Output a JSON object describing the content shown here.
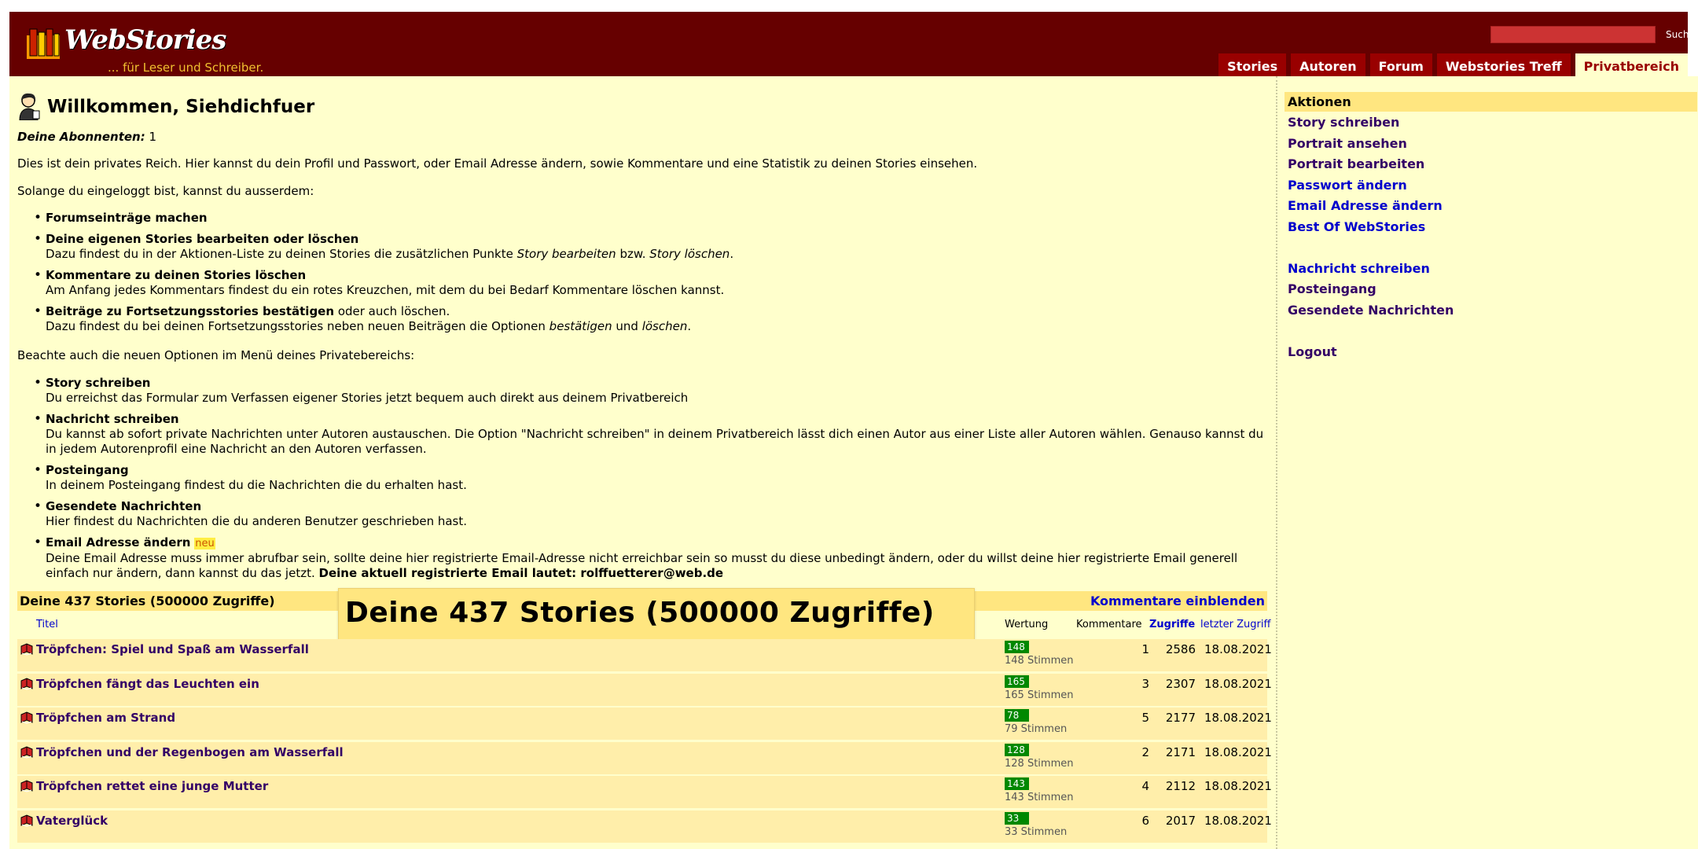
{
  "header": {
    "logo_title": "WebStories",
    "logo_slogan": "... für Leser und Schreiber.",
    "search_button": "Suchen",
    "nav": [
      "Stories",
      "Autoren",
      "Forum",
      "Webstories Treff",
      "Privatbereich"
    ],
    "active_nav": "Privatbereich"
  },
  "welcome": {
    "title": "Willkommen, Siehdichfuer",
    "subscribers_label": "Deine Abonnenten:",
    "subscribers_value": "1",
    "intro": "Dies ist dein privates Reich. Hier kannst du dein Profil und Passwort, oder Email Adresse ändern, sowie Kommentare und eine Statistik zu deinen Stories einsehen.",
    "logged_in_intro": "Solange du eingeloggt bist, kannst du ausserdem:",
    "b1_title": "Forumseinträge machen",
    "b2_title": "Deine eigenen Stories bearbeiten oder löschen",
    "b2_text_a": "Dazu findest du in der Aktionen-Liste zu deinen Stories die zusätzlichen Punkte ",
    "b2_text_it1": "Story bearbeiten",
    "b2_text_b": " bzw. ",
    "b2_text_it2": "Story löschen",
    "b2_text_c": ".",
    "b3_title": "Kommentare zu deinen Stories löschen",
    "b3_text": "Am Anfang jedes Kommentars findest du ein rotes Kreuzchen, mit dem du bei Bedarf Kommentare löschen kannst.",
    "b4_title": "Beiträge zu Fortsetzungsstories bestätigen",
    "b4_title_suffix": " oder auch löschen.",
    "b4_text_a": "Dazu findest du bei deinen Fortsetzungsstories neben neuen Beiträgen die Optionen ",
    "b4_text_it1": "bestätigen",
    "b4_text_b": " und ",
    "b4_text_it2": "löschen",
    "b4_text_c": ".",
    "new_options_intro": "Beachte auch die neuen Optionen im Menü deines Privatebereichs:",
    "n1_title": "Story schreiben",
    "n1_text": "Du erreichst das Formular zum Verfassen eigener Stories jetzt bequem auch direkt aus deinem Privatbereich",
    "n2_title": "Nachricht schreiben",
    "n2_text": "Du kannst ab sofort private Nachrichten unter Autoren austauschen. Die Option \"Nachricht schreiben\" in deinem Privatbereich lässt dich einen Autor aus einer Liste aller Autoren wählen. Genauso kannst du in jedem Autorenprofil eine Nachricht an den Autoren verfassen.",
    "n3_title": "Posteingang",
    "n3_text": "In deinem Posteingang findest du die Nachrichten die du erhalten hast.",
    "n4_title": "Gesendete Nachrichten",
    "n4_text": "Hier findest du Nachrichten die du anderen Benutzer geschrieben hast.",
    "n5_title": "Email Adresse ändern",
    "n5_badge": "neu",
    "n5_text": "Deine Email Adresse muss immer abrufbar sein, sollte deine hier registrierte Email-Adresse nicht erreichbar sein so musst du diese unbedingt ändern, oder du willst deine hier registrierte Email generell einfach nur ändern, dann kannst du das jetzt. ",
    "n5_bold": "Deine aktuell registrierte Email lautet: rolffuetterer@web.de"
  },
  "stories": {
    "bar_title": "Deine 437 Stories (500000 Zugriffe)",
    "zoom_title": "Deine 437 Stories (500000 Zugriffe)",
    "toggle_comments": "Kommentare einblenden",
    "columns": {
      "title": "Titel",
      "rating": "Wertung",
      "comments": "Kommentare",
      "views": "Zugriffe",
      "last": "letzter Zugriff"
    },
    "rows": [
      {
        "title": "Tröpfchen: Spiel und Spaß am Wasserfall",
        "rating": "148",
        "votes": "148 Stimmen",
        "comments": "1",
        "views": "2586",
        "last": "18.08.2021"
      },
      {
        "title": "Tröpfchen fängt das Leuchten ein",
        "rating": "165",
        "votes": "165 Stimmen",
        "comments": "3",
        "views": "2307",
        "last": "18.08.2021"
      },
      {
        "title": "Tröpfchen am Strand",
        "rating": "78",
        "votes": "79 Stimmen",
        "comments": "5",
        "views": "2177",
        "last": "18.08.2021"
      },
      {
        "title": "Tröpfchen und der Regenbogen am Wasserfall",
        "rating": "128",
        "votes": "128 Stimmen",
        "comments": "2",
        "views": "2171",
        "last": "18.08.2021"
      },
      {
        "title": "Tröpfchen rettet eine junge Mutter",
        "rating": "143",
        "votes": "143 Stimmen",
        "comments": "4",
        "views": "2112",
        "last": "18.08.2021"
      },
      {
        "title": "Vaterglück",
        "rating": "33",
        "votes": "33 Stimmen",
        "comments": "6",
        "views": "2017",
        "last": "18.08.2021"
      }
    ]
  },
  "sidebar": {
    "header": "Aktionen",
    "items": [
      "Story schreiben",
      "Portrait ansehen",
      "Portrait bearbeiten",
      "Passwort ändern",
      "Email Adresse ändern",
      "Best Of WebStories",
      "Nachricht schreiben",
      "Posteingang",
      "Gesendete Nachrichten",
      "Logout"
    ]
  },
  "colors": {
    "header_bg": "#660000",
    "tab_bg": "#990000",
    "content_bg": "#ffffcc",
    "row_bg": "#ffeeaa",
    "bar_bg": "#ffe680",
    "rating_green": "#008800",
    "link_blue": "#0000cc",
    "link_purple": "#330066"
  }
}
